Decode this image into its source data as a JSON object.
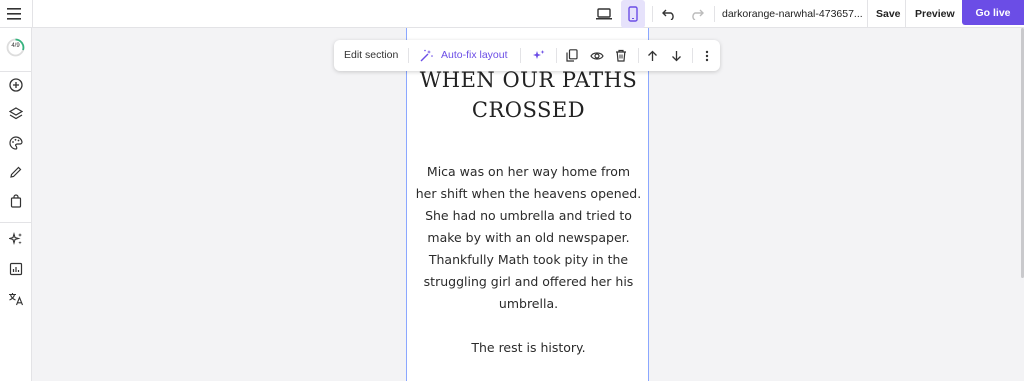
{
  "topbar": {
    "site_name": "darkorange-narwhal-473657...",
    "save_label": "Save",
    "preview_label": "Preview",
    "go_live_label": "Go live",
    "accent": "#6b4de6"
  },
  "sidebar": {
    "progress_label": "4/9",
    "items": [
      "add-icon",
      "layers-icon",
      "palette-icon",
      "pencil-icon",
      "shopping-bag-icon",
      "sparkles-icon",
      "analytics-icon",
      "translate-icon"
    ]
  },
  "section_toolbar": {
    "edit_label": "Edit section",
    "autofix_label": "Auto-fix layout"
  },
  "content": {
    "heading_line1": "WHEN OUR PATHS",
    "heading_line2": "CROSSED",
    "para_lines": [
      "Mica was on her way home from",
      "her shift when the heavens opened.",
      "She had no umbrella and tried to",
      "make by with an old newspaper.",
      "Thankfully Math took pity in the",
      "struggling girl and offered her his",
      "umbrella."
    ],
    "closing": "The rest is history."
  }
}
